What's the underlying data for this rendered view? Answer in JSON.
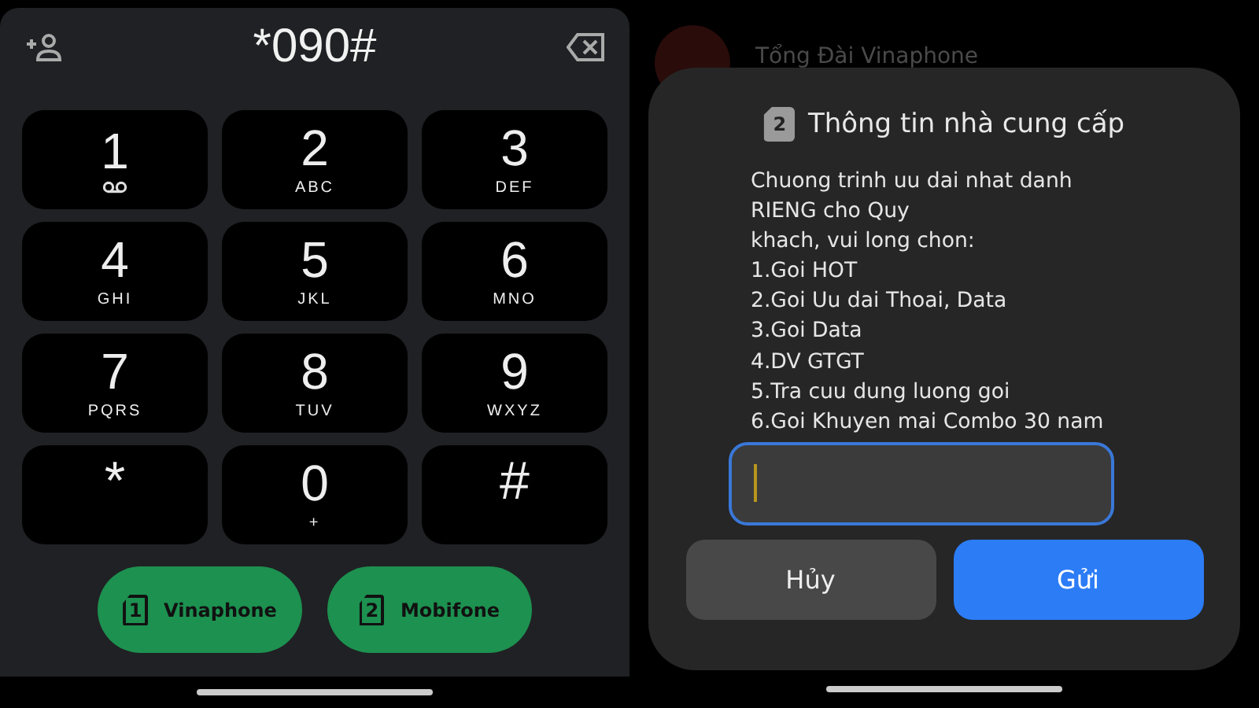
{
  "dialer": {
    "number": "*090#",
    "keys": [
      {
        "digit": "1",
        "kind": "voicemail"
      },
      {
        "digit": "2",
        "kind": "letters",
        "letters": "ABC"
      },
      {
        "digit": "3",
        "kind": "letters",
        "letters": "DEF"
      },
      {
        "digit": "4",
        "kind": "letters",
        "letters": "GHI"
      },
      {
        "digit": "5",
        "kind": "letters",
        "letters": "JKL"
      },
      {
        "digit": "6",
        "kind": "letters",
        "letters": "MNO"
      },
      {
        "digit": "7",
        "kind": "letters",
        "letters": "PQRS"
      },
      {
        "digit": "8",
        "kind": "letters",
        "letters": "TUV"
      },
      {
        "digit": "9",
        "kind": "letters",
        "letters": "WXYZ"
      },
      {
        "digit": "*",
        "kind": "plain"
      },
      {
        "digit": "0",
        "kind": "letters",
        "letters": "+"
      },
      {
        "digit": "#",
        "kind": "plain"
      }
    ],
    "sim_buttons": [
      {
        "slot": "1",
        "label": "Vinaphone"
      },
      {
        "slot": "2",
        "label": "Mobifone"
      }
    ]
  },
  "background_contact": {
    "name": "Tổng Đài Vinaphone"
  },
  "dialog": {
    "sim_slot": "2",
    "title": "Thông tin nhà cung cấp",
    "message_lines": [
      "Chuong trinh uu dai nhat danh",
      "RIENG cho Quy",
      "khach, vui long chon:",
      "1.Goi HOT",
      "2.Goi Uu dai Thoai, Data",
      "3.Goi Data",
      "4.DV GTGT",
      "5.Tra cuu dung luong goi",
      "6.Goi Khuyen mai Combo 30 nam"
    ],
    "reply_field": {
      "focused": true
    },
    "buttons": [
      {
        "label": "Hủy",
        "kind": "secondary"
      },
      {
        "label": "Gửi",
        "kind": "primary"
      }
    ]
  }
}
